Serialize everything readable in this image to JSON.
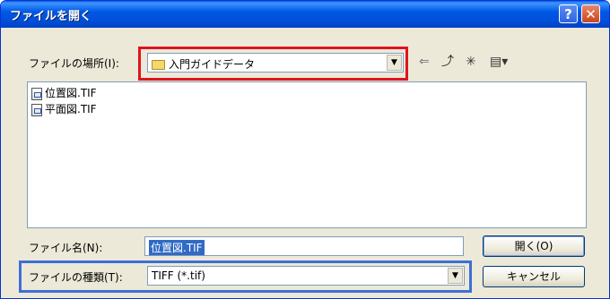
{
  "window": {
    "title": "ファイルを開く",
    "help_glyph": "?",
    "close_glyph": "✕"
  },
  "look_in": {
    "label": "ファイルの場所(I):",
    "value": "入門ガイドデータ"
  },
  "toolbar": {
    "back": "⇐",
    "up": "⤴",
    "new_folder": "✳",
    "view": "▤▾"
  },
  "files": [
    {
      "name": "位置図.TIF"
    },
    {
      "name": "平面図.TIF"
    }
  ],
  "file_name": {
    "label": "ファイル名(N):",
    "value": "位置図.TIF"
  },
  "file_type": {
    "label": "ファイルの種類(T):",
    "value": "TIFF (*.tif)"
  },
  "buttons": {
    "open": "開く(O)",
    "cancel": "キャンセル"
  },
  "colors": {
    "title_bar": "#0058e6",
    "dialog_bg": "#ece9d8",
    "highlight_red": "#e0141e",
    "highlight_blue": "#3d6fd8"
  }
}
